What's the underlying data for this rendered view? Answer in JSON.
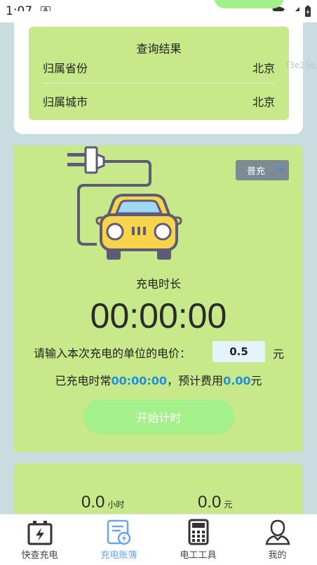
{
  "status_bar": {
    "time": "1:07",
    "notification_icon": "A"
  },
  "result": {
    "title": "查询结果",
    "rows": [
      {
        "label": "归属省份",
        "value": "北京"
      },
      {
        "label": "归属城市",
        "value": "北京"
      }
    ],
    "overflow_text": "f3e25e"
  },
  "charging": {
    "mode_select": {
      "selected": "普充"
    },
    "duration_label": "充电时长",
    "timer": "00:00:00",
    "price_label": "请输入本次充电的单位的电价：",
    "price_value": "0.5",
    "price_unit": "元",
    "summary_prefix": "已充电时常",
    "summary_time": "00:00:00",
    "summary_middle": "，预计费用",
    "summary_cost": "0.00",
    "summary_suffix": "元",
    "start_button": "开始计时"
  },
  "stats": {
    "hours_value": "0.0",
    "hours_unit": "小时",
    "cost_value": "0.0",
    "cost_unit": "元"
  },
  "tabs": [
    {
      "label": "快查充电",
      "icon": "charging-station-icon"
    },
    {
      "label": "充电账簿",
      "icon": "ledger-icon"
    },
    {
      "label": "电工工具",
      "icon": "calculator-icon"
    },
    {
      "label": "我的",
      "icon": "person-icon"
    }
  ],
  "colors": {
    "card_green": "#c7e98a",
    "button_green": "#a4f08a",
    "highlight_blue": "#1f8fe0",
    "active_tab": "#6aa3ee"
  }
}
